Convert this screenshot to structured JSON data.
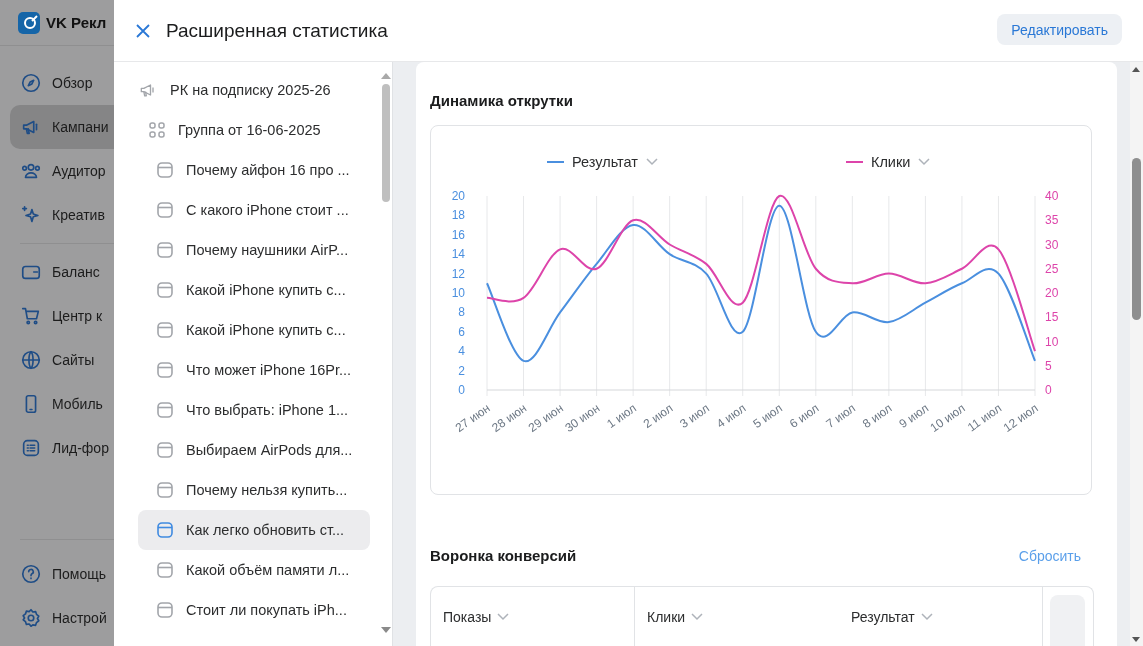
{
  "app": {
    "logo": "VK Рекл",
    "nav": [
      {
        "label": "Обзор",
        "kind": "compass",
        "selected": false
      },
      {
        "label": "Кампани",
        "kind": "megaphone",
        "selected": true
      },
      {
        "label": "Аудитор",
        "kind": "people",
        "selected": false
      },
      {
        "label": "Креатив",
        "kind": "sparkle",
        "selected": false
      },
      {
        "label": "Баланс",
        "kind": "wallet",
        "selected": false
      },
      {
        "label": "Центр к",
        "kind": "cart",
        "selected": false
      },
      {
        "label": "Сайты",
        "kind": "globe",
        "selected": false
      },
      {
        "label": "Мобиль",
        "kind": "phone",
        "selected": false
      },
      {
        "label": "Лид-фор",
        "kind": "list",
        "selected": false
      }
    ],
    "footer": [
      {
        "label": "Помощь",
        "kind": "help",
        "selected": false
      },
      {
        "label": "Настрой",
        "kind": "gear",
        "selected": false
      }
    ]
  },
  "modal": {
    "title": "Расширенная статистика",
    "edit_button": "Редактировать"
  },
  "tree": [
    {
      "label": "РК на подписку 2025-26",
      "kind": "campaign",
      "selected": false,
      "children": [
        {
          "label": "Группа от 16-06-2025",
          "kind": "group",
          "selected": false,
          "children": [
            {
              "label": "Почему айфон 16 про ...",
              "kind": "ad",
              "selected": false
            },
            {
              "label": "С какого iPhone стоит ...",
              "kind": "ad",
              "selected": false
            },
            {
              "label": "Почему наушники AirP...",
              "kind": "ad",
              "selected": false
            },
            {
              "label": "Какой iPhone купить с...",
              "kind": "ad",
              "selected": false
            },
            {
              "label": "Какой iPhone купить с...",
              "kind": "ad",
              "selected": false
            },
            {
              "label": "Что может iPhone 16Pr...",
              "kind": "ad",
              "selected": false
            },
            {
              "label": "Что выбрать: iPhone 1...",
              "kind": "ad",
              "selected": false
            },
            {
              "label": "Выбираем AirPods для...",
              "kind": "ad",
              "selected": false
            },
            {
              "label": "Почему нельзя купить...",
              "kind": "ad",
              "selected": false
            },
            {
              "label": "Как легко обновить ст...",
              "kind": "ad",
              "selected": true
            },
            {
              "label": "Какой объём памяти л...",
              "kind": "ad",
              "selected": false
            },
            {
              "label": "Стоит ли покупать iPh...",
              "kind": "ad",
              "selected": false
            }
          ]
        }
      ]
    }
  ],
  "dynamics": {
    "title": "Динамика открутки",
    "chart_data": {
      "type": "line",
      "categories": [
        "27 июн",
        "28 июн",
        "29 июн",
        "30 июн",
        "1 июл",
        "2 июл",
        "3 июл",
        "4 июл",
        "5 июл",
        "6 июл",
        "7 июл",
        "8 июл",
        "9 июл",
        "10 июл",
        "11 июл",
        "12 июл"
      ],
      "series": [
        {
          "name": "Результат",
          "color": "#4a8fdf",
          "values": [
            11,
            3,
            8,
            13,
            17,
            14,
            12,
            6,
            19,
            6,
            8,
            7,
            9,
            11,
            12,
            3
          ]
        },
        {
          "name": "Клики",
          "color": "#dd44aa",
          "axis": "y2",
          "values": [
            19,
            19,
            29,
            25,
            35,
            30,
            26,
            18,
            40,
            25,
            22,
            24,
            22,
            25,
            29,
            8
          ]
        }
      ],
      "ylim": [
        0,
        20
      ],
      "yticks": [
        0,
        2,
        4,
        6,
        8,
        10,
        12,
        14,
        16,
        18,
        20
      ],
      "y2lim": [
        0,
        40
      ],
      "y2ticks": [
        0,
        5,
        10,
        15,
        20,
        25,
        30,
        35,
        40
      ]
    }
  },
  "funnel": {
    "title": "Воронка конверсий",
    "reset": "Сбросить",
    "columns": [
      "Показы",
      "Клики",
      "Результат"
    ]
  }
}
